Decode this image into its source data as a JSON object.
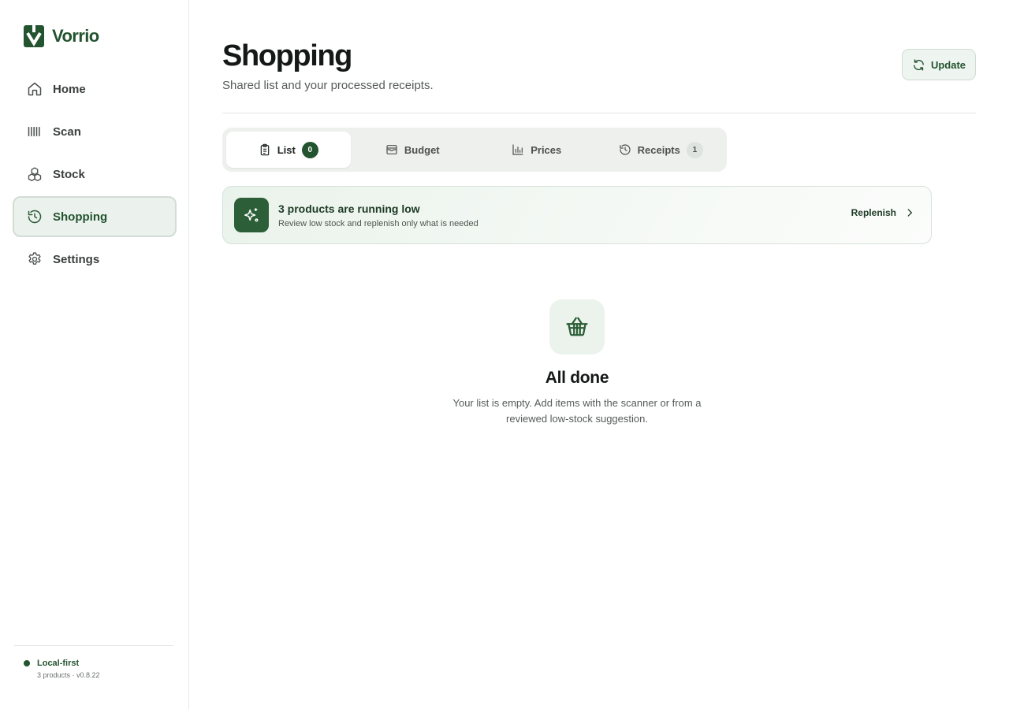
{
  "app": {
    "name": "Vorrio",
    "brand_color": "#23532f"
  },
  "sidebar": {
    "items": [
      {
        "label": "Home",
        "icon": "home-icon",
        "active": false
      },
      {
        "label": "Scan",
        "icon": "barcode-icon",
        "active": false
      },
      {
        "label": "Stock",
        "icon": "boxes-icon",
        "active": false
      },
      {
        "label": "Shopping",
        "icon": "history-icon",
        "active": true
      },
      {
        "label": "Settings",
        "icon": "gear-icon",
        "active": false
      }
    ],
    "footer": {
      "status": "Local-first",
      "meta": "3 products · v0.8.22"
    }
  },
  "header": {
    "title": "Shopping",
    "subtitle": "Shared list and your processed receipts.",
    "update_label": "Update"
  },
  "tabs": [
    {
      "label": "List",
      "icon": "clipboard-icon",
      "badge": "0",
      "active": true
    },
    {
      "label": "Budget",
      "icon": "wallet-icon",
      "badge": "",
      "active": false
    },
    {
      "label": "Prices",
      "icon": "bar-chart-icon",
      "badge": "",
      "active": false
    },
    {
      "label": "Receipts",
      "icon": "history-icon",
      "badge": "1",
      "active": false
    }
  ],
  "alert": {
    "title": "3 products are running low",
    "subtitle": "Review low stock and replenish only what is needed",
    "action_label": "Replenish",
    "icon": "sparkles-icon"
  },
  "empty_state": {
    "icon": "basket-icon",
    "title": "All done",
    "text": "Your list is empty. Add items with the scanner or from a reviewed low-stock suggestion."
  }
}
